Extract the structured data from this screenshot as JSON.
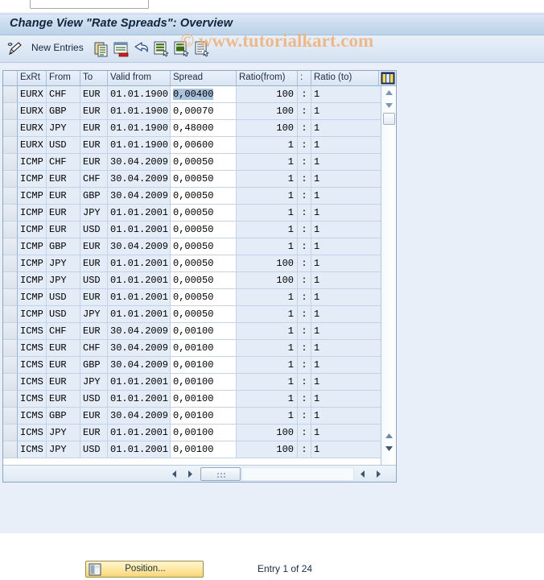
{
  "window": {
    "command_field_value": "",
    "command_field_placeholder": ""
  },
  "title": {
    "text": "Change View \"Rate Spreads\": Overview"
  },
  "watermark": {
    "text": "© www.tutorialkart.com",
    "color": "#f0b078"
  },
  "toolbar": {
    "pencil_icon": "pencil-icon",
    "new_entries_label": "New Entries",
    "icons": [
      {
        "name": "copy-icon"
      },
      {
        "name": "delete-row-icon"
      },
      {
        "name": "undo-icon"
      },
      {
        "name": "select-all-icon"
      },
      {
        "name": "deselect-all-icon"
      },
      {
        "name": "details-icon"
      }
    ]
  },
  "grid": {
    "columns": [
      {
        "key": "selector",
        "label": ""
      },
      {
        "key": "exrt",
        "label": "ExRt"
      },
      {
        "key": "from",
        "label": "From"
      },
      {
        "key": "to",
        "label": "To"
      },
      {
        "key": "valid",
        "label": "Valid from"
      },
      {
        "key": "spread",
        "label": "Spread"
      },
      {
        "key": "ratio_from",
        "label": "Ratio(from)"
      },
      {
        "key": "colon",
        "label": ":"
      },
      {
        "key": "ratio_to",
        "label": "Ratio (to)"
      }
    ],
    "config_icon": "table-settings-icon",
    "selected_cell": {
      "row": 0,
      "column": "spread"
    },
    "rows": [
      {
        "exrt": "EURX",
        "from": "CHF",
        "to": "EUR",
        "valid": "01.01.1900",
        "spread": "0,00400",
        "ratio_from": "100",
        "colon": ":",
        "ratio_to": "1"
      },
      {
        "exrt": "EURX",
        "from": "GBP",
        "to": "EUR",
        "valid": "01.01.1900",
        "spread": "0,00070",
        "ratio_from": "100",
        "colon": ":",
        "ratio_to": "1"
      },
      {
        "exrt": "EURX",
        "from": "JPY",
        "to": "EUR",
        "valid": "01.01.1900",
        "spread": "0,48000",
        "ratio_from": "100",
        "colon": ":",
        "ratio_to": "1"
      },
      {
        "exrt": "EURX",
        "from": "USD",
        "to": "EUR",
        "valid": "01.01.1900",
        "spread": "0,00600",
        "ratio_from": "1",
        "colon": ":",
        "ratio_to": "1"
      },
      {
        "exrt": "ICMP",
        "from": "CHF",
        "to": "EUR",
        "valid": "30.04.2009",
        "spread": "0,00050",
        "ratio_from": "1",
        "colon": ":",
        "ratio_to": "1"
      },
      {
        "exrt": "ICMP",
        "from": "EUR",
        "to": "CHF",
        "valid": "30.04.2009",
        "spread": "0,00050",
        "ratio_from": "1",
        "colon": ":",
        "ratio_to": "1"
      },
      {
        "exrt": "ICMP",
        "from": "EUR",
        "to": "GBP",
        "valid": "30.04.2009",
        "spread": "0,00050",
        "ratio_from": "1",
        "colon": ":",
        "ratio_to": "1"
      },
      {
        "exrt": "ICMP",
        "from": "EUR",
        "to": "JPY",
        "valid": "01.01.2001",
        "spread": "0,00050",
        "ratio_from": "1",
        "colon": ":",
        "ratio_to": "1"
      },
      {
        "exrt": "ICMP",
        "from": "EUR",
        "to": "USD",
        "valid": "01.01.2001",
        "spread": "0,00050",
        "ratio_from": "1",
        "colon": ":",
        "ratio_to": "1"
      },
      {
        "exrt": "ICMP",
        "from": "GBP",
        "to": "EUR",
        "valid": "30.04.2009",
        "spread": "0,00050",
        "ratio_from": "1",
        "colon": ":",
        "ratio_to": "1"
      },
      {
        "exrt": "ICMP",
        "from": "JPY",
        "to": "EUR",
        "valid": "01.01.2001",
        "spread": "0,00050",
        "ratio_from": "100",
        "colon": ":",
        "ratio_to": "1"
      },
      {
        "exrt": "ICMP",
        "from": "JPY",
        "to": "USD",
        "valid": "01.01.2001",
        "spread": "0,00050",
        "ratio_from": "100",
        "colon": ":",
        "ratio_to": "1"
      },
      {
        "exrt": "ICMP",
        "from": "USD",
        "to": "EUR",
        "valid": "01.01.2001",
        "spread": "0,00050",
        "ratio_from": "1",
        "colon": ":",
        "ratio_to": "1"
      },
      {
        "exrt": "ICMP",
        "from": "USD",
        "to": "JPY",
        "valid": "01.01.2001",
        "spread": "0,00050",
        "ratio_from": "1",
        "colon": ":",
        "ratio_to": "1"
      },
      {
        "exrt": "ICMS",
        "from": "CHF",
        "to": "EUR",
        "valid": "30.04.2009",
        "spread": "0,00100",
        "ratio_from": "1",
        "colon": ":",
        "ratio_to": "1"
      },
      {
        "exrt": "ICMS",
        "from": "EUR",
        "to": "CHF",
        "valid": "30.04.2009",
        "spread": "0,00100",
        "ratio_from": "1",
        "colon": ":",
        "ratio_to": "1"
      },
      {
        "exrt": "ICMS",
        "from": "EUR",
        "to": "GBP",
        "valid": "30.04.2009",
        "spread": "0,00100",
        "ratio_from": "1",
        "colon": ":",
        "ratio_to": "1"
      },
      {
        "exrt": "ICMS",
        "from": "EUR",
        "to": "JPY",
        "valid": "01.01.2001",
        "spread": "0,00100",
        "ratio_from": "1",
        "colon": ":",
        "ratio_to": "1"
      },
      {
        "exrt": "ICMS",
        "from": "EUR",
        "to": "USD",
        "valid": "01.01.2001",
        "spread": "0,00100",
        "ratio_from": "1",
        "colon": ":",
        "ratio_to": "1"
      },
      {
        "exrt": "ICMS",
        "from": "GBP",
        "to": "EUR",
        "valid": "30.04.2009",
        "spread": "0,00100",
        "ratio_from": "1",
        "colon": ":",
        "ratio_to": "1"
      },
      {
        "exrt": "ICMS",
        "from": "JPY",
        "to": "EUR",
        "valid": "01.01.2001",
        "spread": "0,00100",
        "ratio_from": "100",
        "colon": ":",
        "ratio_to": "1"
      },
      {
        "exrt": "ICMS",
        "from": "JPY",
        "to": "USD",
        "valid": "01.01.2001",
        "spread": "0,00100",
        "ratio_from": "100",
        "colon": ":",
        "ratio_to": "1"
      }
    ]
  },
  "footer": {
    "position_button_label": "Position...",
    "position_icon": "position-icon",
    "entry_status": "Entry 1 of 24"
  }
}
